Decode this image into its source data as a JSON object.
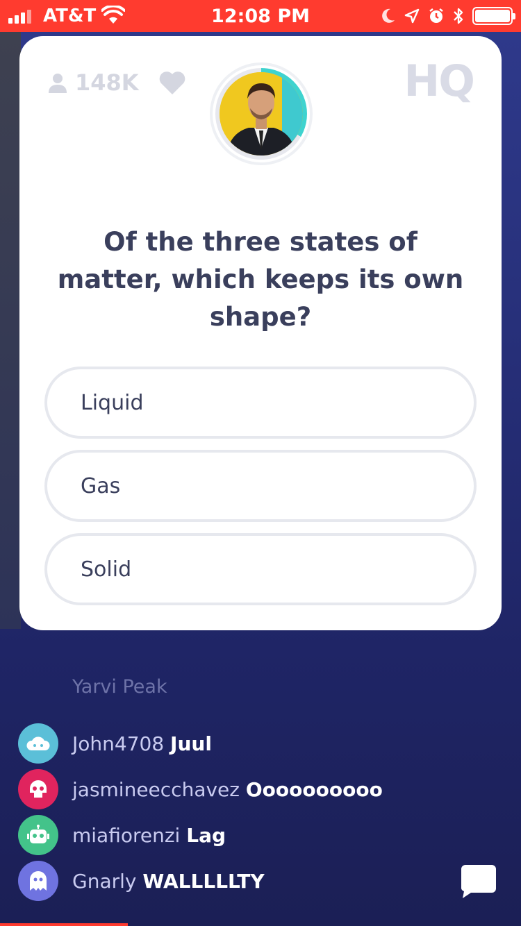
{
  "status_bar": {
    "carrier": "AT&T",
    "time": "12:08 PM",
    "bar_color": "#ff3b2f"
  },
  "header": {
    "viewer_count": "148K",
    "logo": "HQ"
  },
  "question": {
    "text": "Of the three states of matter, which keeps its own shape?"
  },
  "answers": [
    {
      "label": "Liquid"
    },
    {
      "label": "Gas"
    },
    {
      "label": "Solid"
    }
  ],
  "chat": {
    "faded_user": "Yarvi Peak",
    "messages": [
      {
        "user": "John4708",
        "message": "Juul",
        "avatar_icon": "cloud-icon",
        "avatar_color": "#5bbfd8"
      },
      {
        "user": "jasmineecchavez",
        "message": "Oooooooooo",
        "avatar_icon": "skull-icon",
        "avatar_color": "#e0245e"
      },
      {
        "user": "miafiorenzi",
        "message": "Lag",
        "avatar_icon": "robot-icon",
        "avatar_color": "#43c38a"
      },
      {
        "user": "Gnarly",
        "message": "WALLLLLTY",
        "avatar_icon": "ghost-icon",
        "avatar_color": "#6f73e0"
      }
    ]
  },
  "colors": {
    "accent_ring": "#3fd3cf",
    "card_text": "#3a3f5c",
    "background": "#27307a"
  }
}
